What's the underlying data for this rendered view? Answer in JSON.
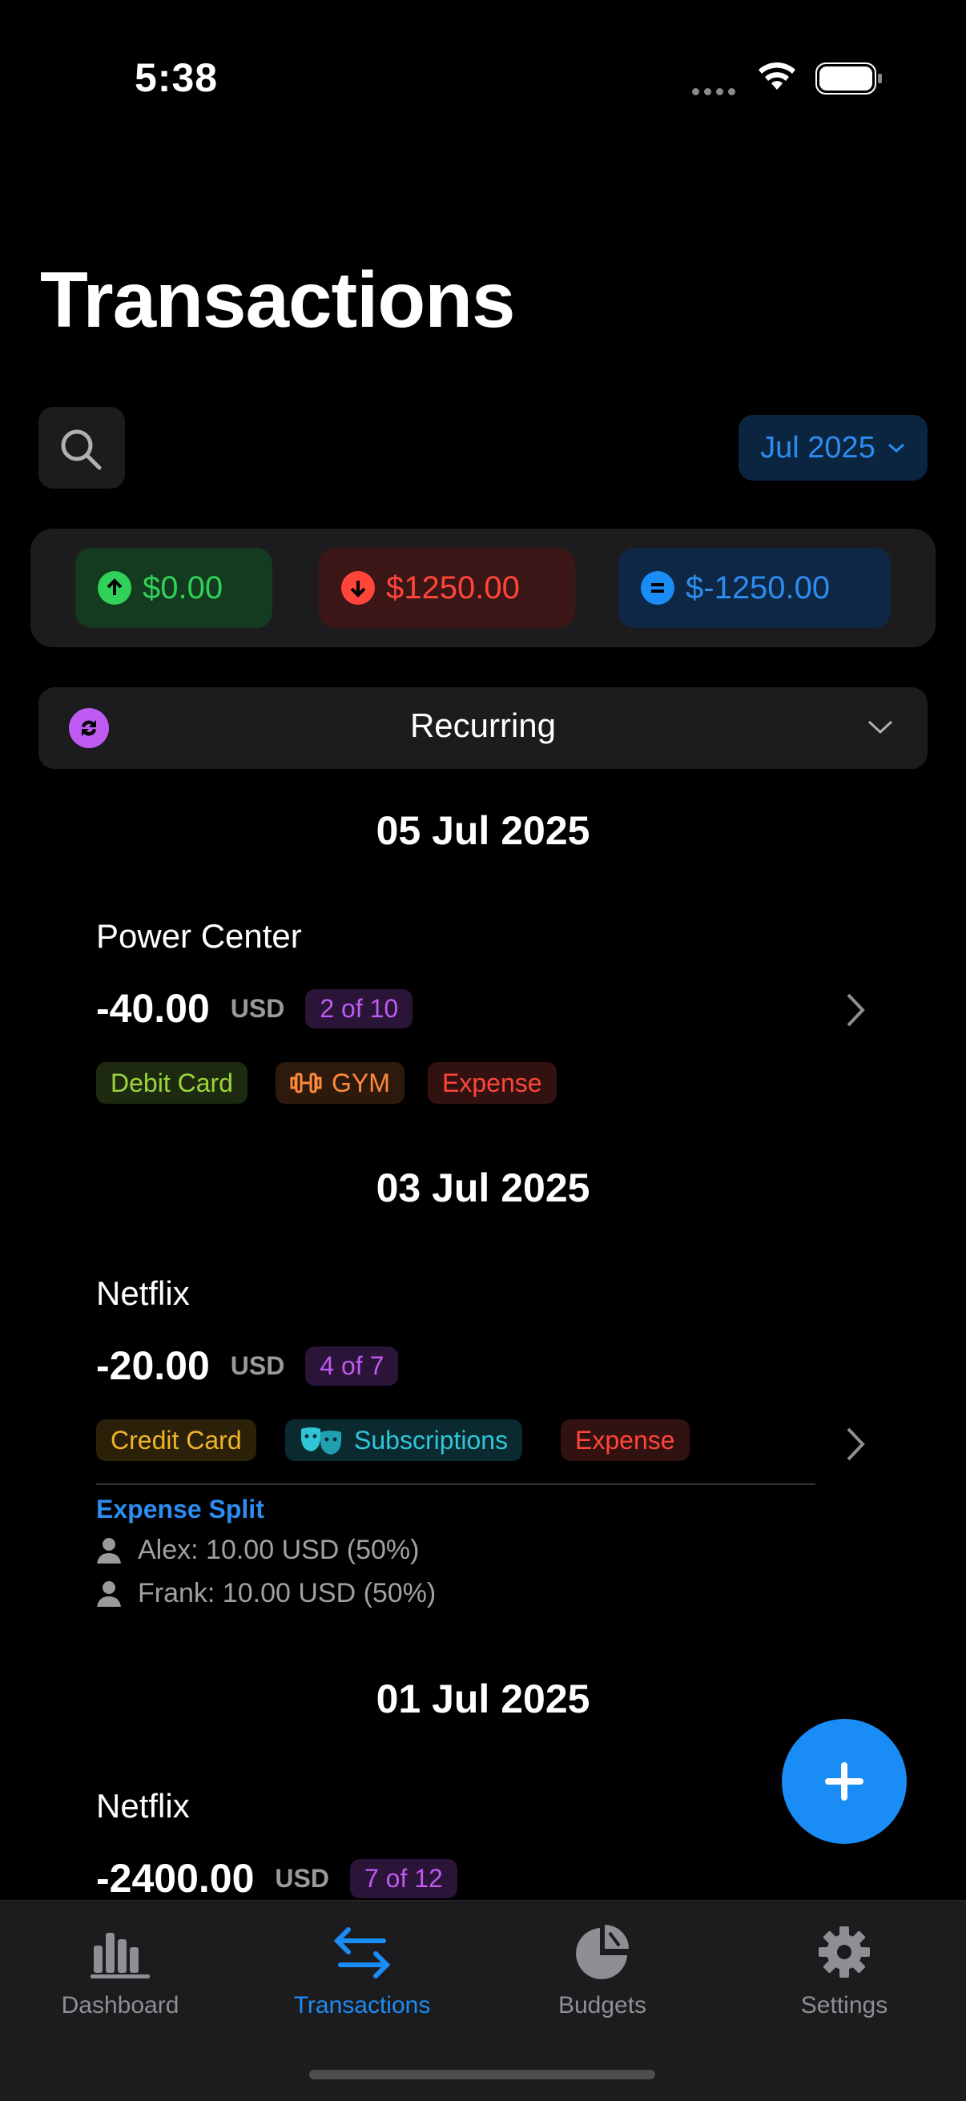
{
  "status_bar": {
    "time": "5:38"
  },
  "page": {
    "title": "Transactions"
  },
  "filters": {
    "month": "Jul 2025"
  },
  "summary": {
    "income": "$0.00",
    "expense": "$1250.00",
    "net": "$-1250.00"
  },
  "recurring": {
    "label": "Recurring"
  },
  "groups": [
    {
      "date": "05 Jul 2025",
      "name": "Power Center",
      "amount": "-40.00",
      "currency": "USD",
      "progress": "2 of 10",
      "tags": [
        "Debit Card",
        "GYM",
        "Expense"
      ]
    },
    {
      "date": "03 Jul 2025",
      "name": "Netflix",
      "amount": "-20.00",
      "currency": "USD",
      "progress": "4 of 7",
      "tags": [
        "Credit Card",
        "Subscriptions",
        "Expense"
      ],
      "split_title": "Expense Split",
      "splits": [
        "Alex: 10.00 USD (50%)",
        "Frank: 10.00 USD (50%)"
      ]
    },
    {
      "date": "01 Jul 2025",
      "name": "Netflix",
      "amount": "-2400.00",
      "currency": "USD",
      "progress": "7 of 12"
    }
  ],
  "tabs": [
    {
      "label": "Dashboard",
      "icon": "bar-chart-icon"
    },
    {
      "label": "Transactions",
      "icon": "arrows-swap-icon"
    },
    {
      "label": "Budgets",
      "icon": "pie-chart-icon"
    },
    {
      "label": "Settings",
      "icon": "gear-icon"
    }
  ],
  "colors": {
    "accent": "#1a8cf5",
    "income": "#30d158",
    "expense": "#ff453a",
    "recurring_badge": "#bf5af2"
  }
}
